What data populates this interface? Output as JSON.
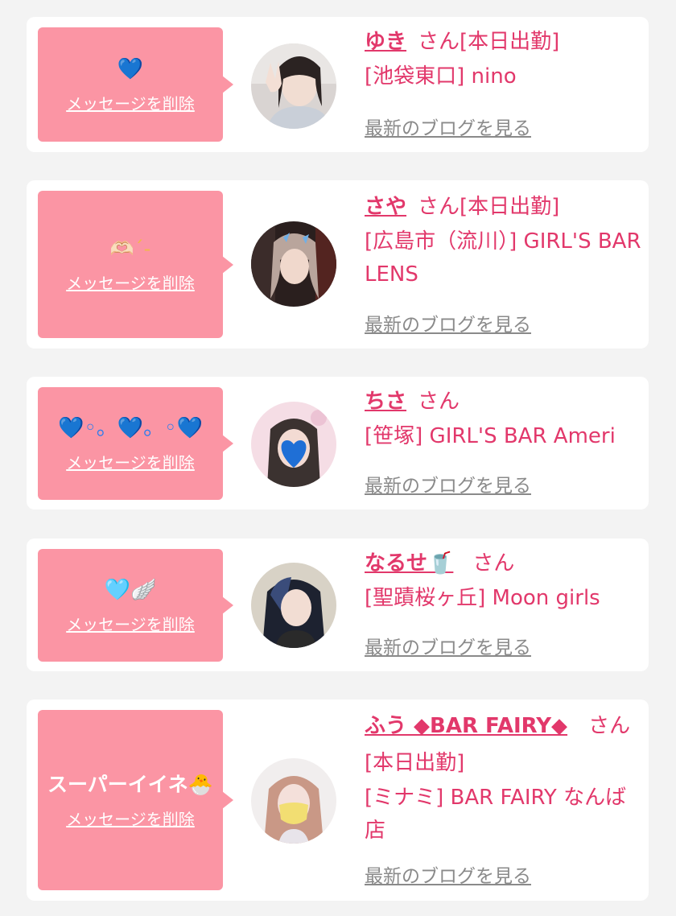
{
  "delete_label": "メッセージを削除",
  "blog_label": "最新のブログを見る",
  "san_label": "さん",
  "colors": {
    "accent": "#e2386b",
    "bubble": "#fb95a4",
    "link_gray": "#8a8a8a",
    "card_bg": "#ffffff",
    "page_bg": "#f3f3f3"
  },
  "entries": [
    {
      "message": "💙",
      "name": "ゆき",
      "status": "[本日出勤]",
      "shop": "[池袋東口] nino",
      "avatar_icon": "avatar-photo"
    },
    {
      "message": "🫶🏻´-",
      "name": "さや",
      "status": "[本日出勤]",
      "shop": "[広島市（流川）] GIRL'S BAR LENS",
      "avatar_icon": "avatar-photo"
    },
    {
      "message": "💙◦。💙。◦💙",
      "name": "ちさ",
      "status": "",
      "shop": "[笹塚] GIRL'S BAR Ameri",
      "avatar_icon": "avatar-photo"
    },
    {
      "message": "🩵🪽",
      "name": "なるせ🥤",
      "status": "",
      "shop": "[聖蹟桜ヶ丘] Moon girls",
      "avatar_icon": "avatar-photo"
    },
    {
      "message": "スーパーイイネ🐣",
      "name": "ふう ◆BAR FAIRY◆",
      "status": "[本日出勤]",
      "shop": "[ミナミ] BAR FAIRY なんば店",
      "avatar_icon": "avatar-photo"
    }
  ]
}
